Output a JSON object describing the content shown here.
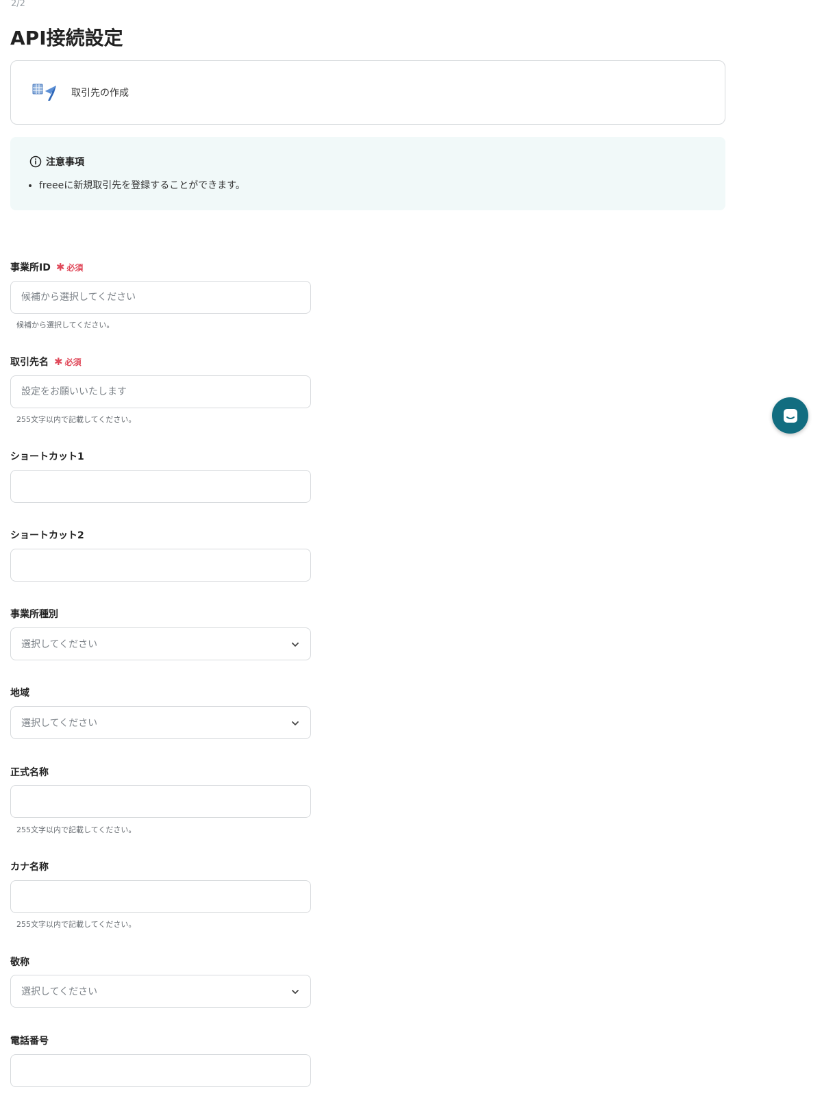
{
  "header": {
    "step": "2/2",
    "title": "API接続設定"
  },
  "app": {
    "name": "取引先の作成",
    "icon": "freee-app-icon"
  },
  "notice": {
    "title": "注意事項",
    "items": [
      "freeeに新規取引先を登録することができます。"
    ],
    "icon": "info-icon"
  },
  "required_badge": "必須",
  "fields": [
    {
      "label": "事業所ID",
      "required": true,
      "type": "text",
      "value": "",
      "placeholder": "候補から選択してください",
      "hint": "候補から選択してください。"
    },
    {
      "label": "取引先名",
      "required": true,
      "type": "text",
      "value": "",
      "placeholder": "設定をお願いいたします",
      "hint": "255文字以内で記載してください。"
    },
    {
      "label": "ショートカット1",
      "required": false,
      "type": "text",
      "value": "",
      "placeholder": "",
      "hint": ""
    },
    {
      "label": "ショートカット2",
      "required": false,
      "type": "text",
      "value": "",
      "placeholder": "",
      "hint": ""
    },
    {
      "label": "事業所種別",
      "required": false,
      "type": "select",
      "value": "選択してください",
      "hint": ""
    },
    {
      "label": "地域",
      "required": false,
      "type": "select",
      "value": "選択してください",
      "hint": ""
    },
    {
      "label": "正式名称",
      "required": false,
      "type": "text",
      "value": "",
      "placeholder": "",
      "hint": "255文字以内で記載してください。"
    },
    {
      "label": "カナ名称",
      "required": false,
      "type": "text",
      "value": "",
      "placeholder": "",
      "hint": "255文字以内で記載してください。"
    },
    {
      "label": "敬称",
      "required": false,
      "type": "select",
      "value": "選択してください",
      "hint": ""
    },
    {
      "label": "電話番号",
      "required": false,
      "type": "text",
      "value": "",
      "placeholder": "",
      "hint": ""
    }
  ],
  "chat": {
    "icon": "chat-icon"
  },
  "colors": {
    "accent": "#126d80",
    "required": "#e0495a",
    "notice_bg": "#f1f9f9",
    "border": "#d6d9dc"
  }
}
